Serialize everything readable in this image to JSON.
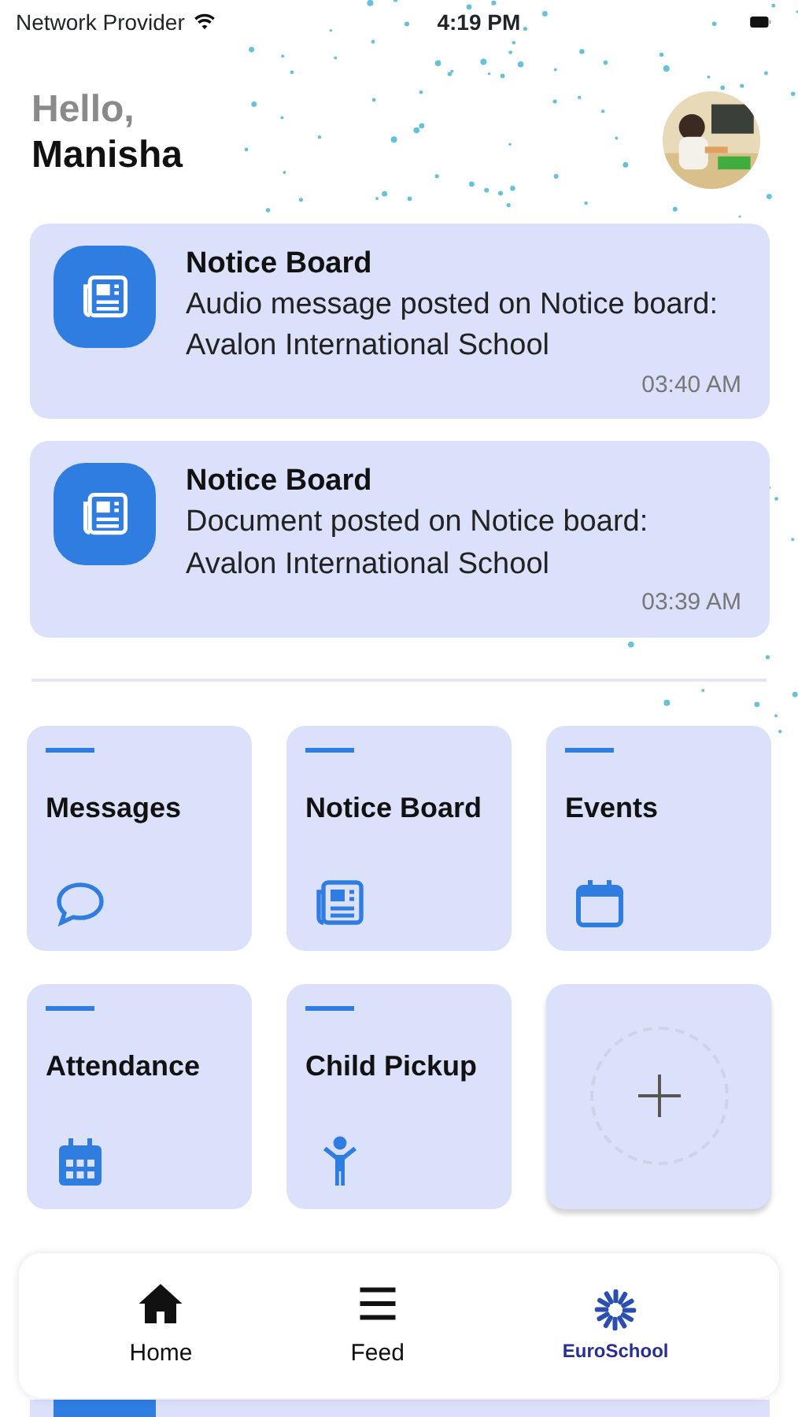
{
  "status_bar": {
    "carrier": "Network Provider",
    "time": "4:19 PM"
  },
  "greeting": {
    "hello": "Hello,",
    "name": "Manisha"
  },
  "notifications": [
    {
      "title": "Notice Board",
      "message": "Audio message posted on Notice board: Avalon International School",
      "time": "03:40 AM"
    },
    {
      "title": "Notice Board",
      "message": "Document posted on Notice board: Avalon International School",
      "time": "03:39 AM"
    }
  ],
  "tiles": [
    {
      "kind": "module",
      "label": "Messages"
    },
    {
      "kind": "module",
      "label": "Notice Board"
    },
    {
      "kind": "module",
      "label": "Events"
    },
    {
      "kind": "module",
      "label": "Attendance"
    },
    {
      "kind": "module",
      "label": "Child Pickup"
    },
    {
      "kind": "add"
    }
  ],
  "bottom_nav": [
    {
      "kind": "tab",
      "label": "Home"
    },
    {
      "kind": "tab",
      "label": "Feed"
    },
    {
      "kind": "logo",
      "label": "EuroSchool"
    }
  ]
}
